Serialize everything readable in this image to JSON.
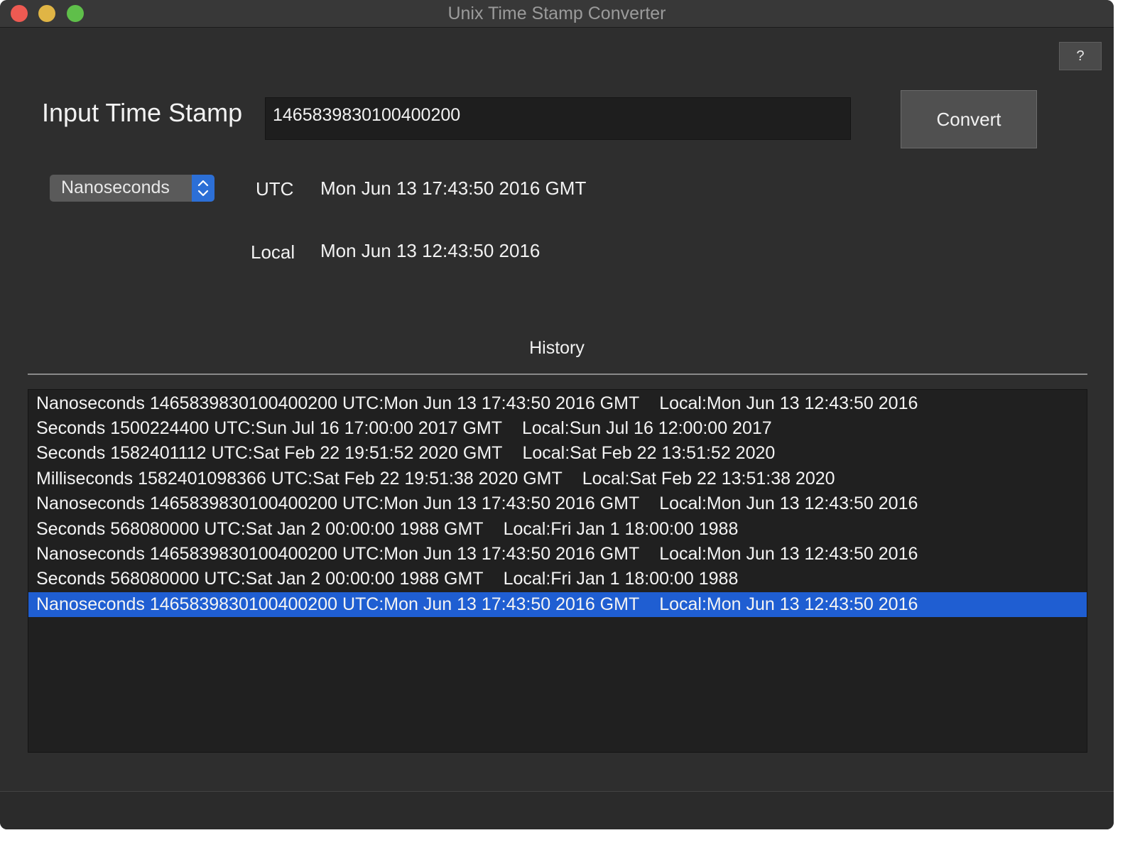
{
  "window": {
    "title": "Unix Time Stamp Converter"
  },
  "toolbar": {
    "help_label": "?"
  },
  "input": {
    "label": "Input Time Stamp",
    "value": "1465839830100400200"
  },
  "convert": {
    "label": "Convert"
  },
  "unit_select": {
    "selected": "Nanoseconds"
  },
  "result": {
    "utc_label": "UTC",
    "utc_value": "Mon Jun 13 17:43:50 2016 GMT",
    "local_label": "Local",
    "local_value": "Mon Jun 13 12:43:50 2016"
  },
  "history": {
    "title": "History",
    "selected_index": 8,
    "rows": [
      {
        "main": "Nanoseconds 1465839830100400200 UTC:Mon Jun 13 17:43:50 2016 GMT",
        "local": "Local:Mon Jun 13 12:43:50 2016"
      },
      {
        "main": "Seconds 1500224400 UTC:Sun Jul 16 17:00:00 2017 GMT",
        "local": "Local:Sun Jul 16 12:00:00 2017"
      },
      {
        "main": "Seconds 1582401112 UTC:Sat Feb 22 19:51:52 2020 GMT",
        "local": "Local:Sat Feb 22 13:51:52 2020"
      },
      {
        "main": "Milliseconds 1582401098366 UTC:Sat Feb 22 19:51:38 2020 GMT",
        "local": "Local:Sat Feb 22 13:51:38 2020"
      },
      {
        "main": "Nanoseconds 1465839830100400200 UTC:Mon Jun 13 17:43:50 2016 GMT",
        "local": "Local:Mon Jun 13 12:43:50 2016"
      },
      {
        "main": "Seconds 568080000 UTC:Sat Jan 2 00:00:00 1988 GMT",
        "local": "Local:Fri Jan 1 18:00:00 1988"
      },
      {
        "main": "Nanoseconds 1465839830100400200 UTC:Mon Jun 13 17:43:50 2016 GMT",
        "local": "Local:Mon Jun 13 12:43:50 2016"
      },
      {
        "main": "Seconds 568080000 UTC:Sat Jan 2 00:00:00 1988 GMT",
        "local": "Local:Fri Jan 1 18:00:00 1988"
      },
      {
        "main": "Nanoseconds 1465839830100400200 UTC:Mon Jun 13 17:43:50 2016 GMT",
        "local": "Local:Mon Jun 13 12:43:50 2016"
      }
    ]
  },
  "colors": {
    "window_bg": "#2e2e2e",
    "accent": "#2c6fd6",
    "selection": "#1f5ed2",
    "close": "#ee5a52",
    "minimize": "#e0b545",
    "zoom": "#5fbf4a"
  },
  "icons": {
    "stepper": "chevron-up-down-icon"
  }
}
